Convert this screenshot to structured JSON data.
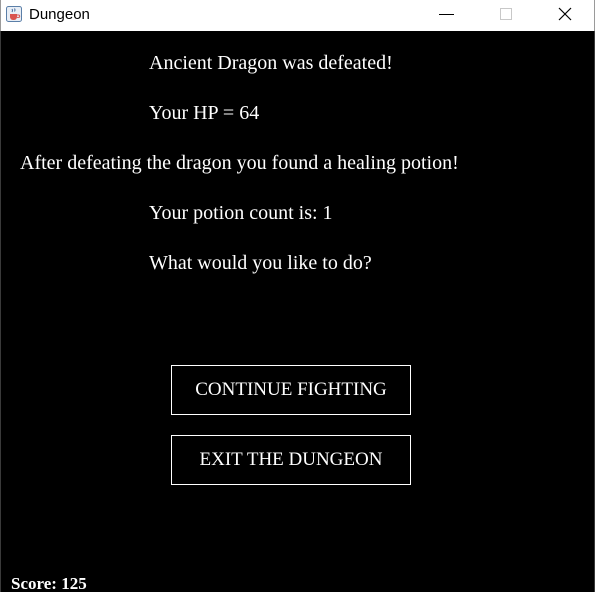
{
  "window": {
    "title": "Dungeon",
    "icon": "java-cup-icon"
  },
  "game": {
    "messages": {
      "defeat": "Ancient Dragon was defeated!",
      "hp": "Your HP = 64",
      "found": "After defeating the dragon you found a healing potion!",
      "potions": "Your potion count is: 1",
      "prompt": "What would you like to do?"
    },
    "buttons": {
      "continue": "CONTINUE FIGHTING",
      "exit": "EXIT THE DUNGEON"
    },
    "score_label": "Score: 125"
  },
  "colors": {
    "background": "#000000",
    "text": "#ffffff",
    "button_border": "#ffffff"
  }
}
